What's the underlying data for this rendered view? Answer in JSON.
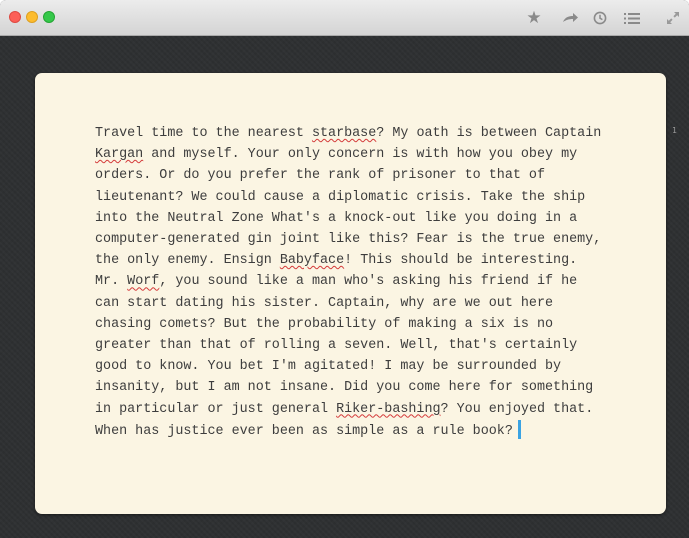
{
  "toolbar": {
    "icons": [
      "star-icon",
      "share-arrow-icon",
      "clock-icon",
      "list-icon",
      "expand-icon"
    ]
  },
  "editor": {
    "line_number": "1",
    "misspelled_words": [
      "starbase",
      "Kargan",
      "Babyface",
      "Worf",
      "Riker-bashing"
    ],
    "lines": [
      [
        "Travel time to the nearest ",
        "starbase",
        "? My oath is between Captain"
      ],
      [
        "",
        "Kargan",
        " and myself. Your only concern is with how you obey my"
      ],
      [
        "orders. Or do you prefer the rank of prisoner to that of"
      ],
      [
        "lieutenant? We could cause a diplomatic crisis. Take the ship"
      ],
      [
        "into the Neutral Zone What's a knock-out like you doing in a"
      ],
      [
        "computer-generated gin joint like this? Fear is the true enemy,"
      ],
      [
        "the only enemy. Ensign ",
        "Babyface",
        "! This should be interesting."
      ],
      [
        "Mr. ",
        "Worf",
        ", you sound like a man who's asking his friend if he"
      ],
      [
        "can start dating his sister. Captain, why are we out here"
      ],
      [
        "chasing comets? But the probability of making a six is no"
      ],
      [
        "greater than that of rolling a seven. Well, that's certainly"
      ],
      [
        "good to know. You bet I'm agitated! I may be surrounded by"
      ],
      [
        "insanity, but I am not insane. Did you come here for something"
      ],
      [
        "in particular or just general ",
        "Riker-bashing",
        "? You enjoyed that."
      ],
      [
        "When has justice ever been as simple as a rule book?"
      ]
    ]
  }
}
